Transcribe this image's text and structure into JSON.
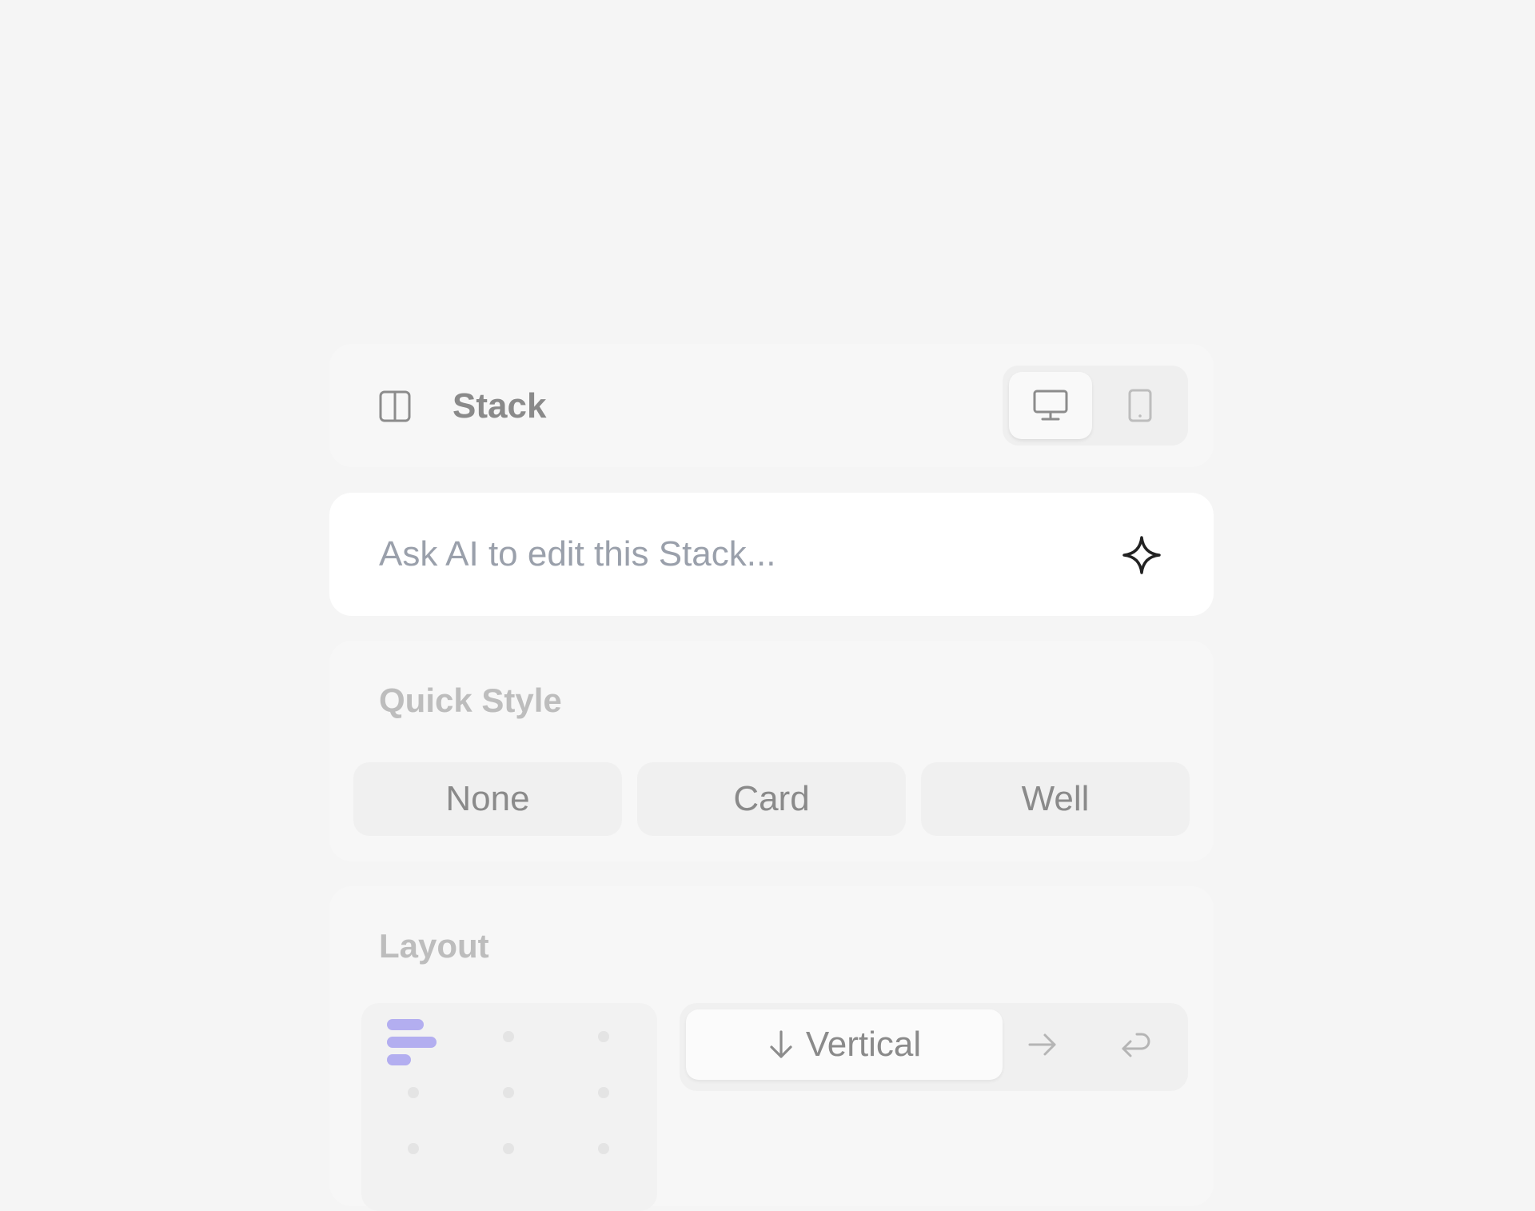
{
  "header": {
    "icon": "columns-panel-icon",
    "title": "Stack",
    "device_toggle": [
      {
        "icon": "desktop-icon",
        "selected": true
      },
      {
        "icon": "mobile-icon",
        "selected": false
      }
    ]
  },
  "ai": {
    "placeholder": "Ask AI to edit this Stack...",
    "icon": "sparkle-icon"
  },
  "quick_style": {
    "title": "Quick Style",
    "options": [
      "None",
      "Card",
      "Well"
    ]
  },
  "layout": {
    "title": "Layout",
    "alignment_icon": "align-left-bars-icon",
    "direction": {
      "selected_label": "Vertical",
      "selected_icon": "arrow-down-icon",
      "other_icons": [
        "arrow-right-icon",
        "wrap-return-icon"
      ]
    }
  },
  "colors": {
    "background": "#f5f5f5",
    "accent": "#b3aef0"
  }
}
